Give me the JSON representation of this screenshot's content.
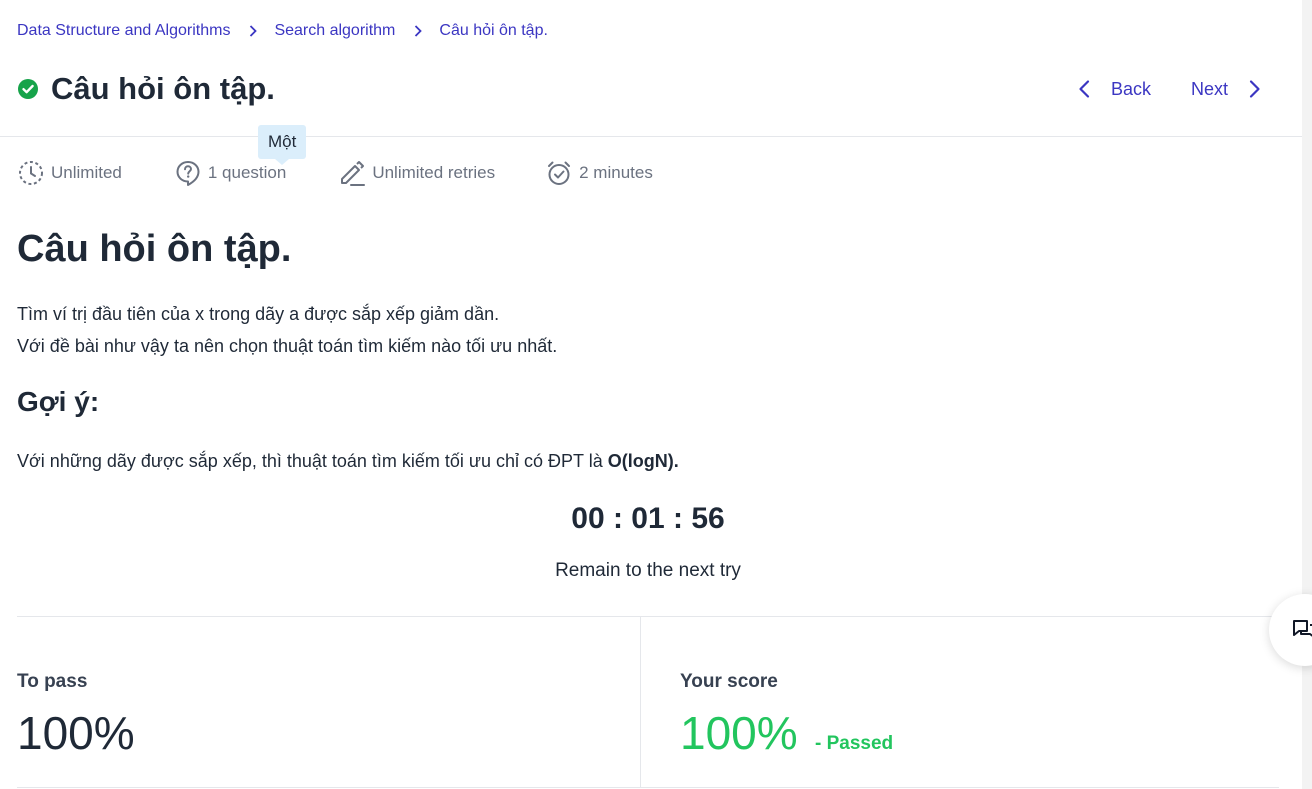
{
  "breadcrumb": {
    "items": [
      "Data Structure and Algorithms",
      "Search algorithm",
      "Câu hỏi ôn tập."
    ]
  },
  "header": {
    "title": "Câu hỏi ôn tập.",
    "back_label": "Back",
    "next_label": "Next",
    "status_icon": "check-circle-icon",
    "status_color": "#16a34a"
  },
  "meta": {
    "time_limit": "Unlimited",
    "questions": "1 question",
    "retries": "Unlimited retries",
    "duration": "2 minutes",
    "tooltip": "Một"
  },
  "content": {
    "title": "Câu hỏi ôn tập.",
    "line1": "Tìm ví trị đầu tiên của x trong dãy a được sắp xếp giảm dần.",
    "line2": "Với đề bài như vậy ta nên chọn thuật toán tìm kiếm nào tối ưu nhất.",
    "hint_title": "Gợi ý:",
    "hint_text": "Với những dãy được sắp xếp, thì thuật toán tìm kiếm tối ưu chỉ có ĐPT là ",
    "hint_bold": "O(logN)."
  },
  "countdown": {
    "time": "00 : 01 : 56",
    "label": "Remain to the next try"
  },
  "score": {
    "pass_label": "To pass",
    "pass_value": "100%",
    "your_label": "Your score",
    "your_value": "100%",
    "status": "- Passed",
    "pass_color": "#22c55e"
  },
  "colors": {
    "accent": "#3b36c2",
    "text": "#1f2937",
    "muted": "#6b7280"
  }
}
